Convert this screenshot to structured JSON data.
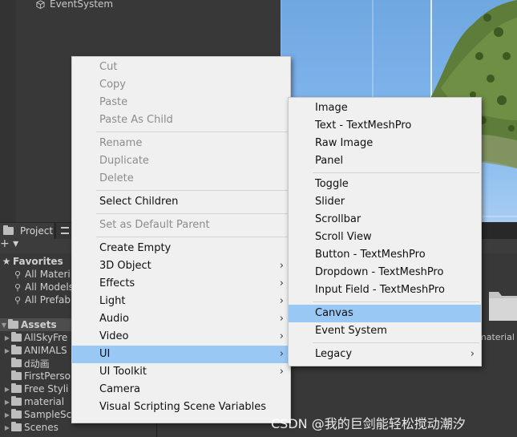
{
  "hierarchy": {
    "items": [
      {
        "label": "EventSystem"
      }
    ]
  },
  "project_panel": {
    "tab_label": "Project",
    "favorites": {
      "label": "Favorites",
      "items": [
        "All Materi",
        "All Models",
        "All Prefab"
      ]
    },
    "assets": {
      "label": "Assets",
      "folders": [
        "AllSkyFre",
        "ANIMALS",
        "d动画",
        "FirstPerso",
        "Free Styli",
        "material",
        "SampleSc",
        "Scenes"
      ]
    },
    "grid_folder_label": "material"
  },
  "context_menu": {
    "items": [
      {
        "label": "Cut",
        "disabled": true
      },
      {
        "label": "Copy",
        "disabled": true
      },
      {
        "label": "Paste",
        "disabled": true
      },
      {
        "label": "Paste As Child",
        "disabled": true
      },
      {
        "label": "Rename",
        "disabled": true
      },
      {
        "label": "Duplicate",
        "disabled": true
      },
      {
        "label": "Delete",
        "disabled": true
      },
      {
        "label": "Select Children",
        "disabled": false
      },
      {
        "label": "Set as Default Parent",
        "disabled": true
      },
      {
        "label": "Create Empty",
        "disabled": false
      },
      {
        "label": "3D Object",
        "disabled": false,
        "submenu": true
      },
      {
        "label": "Effects",
        "disabled": false,
        "submenu": true
      },
      {
        "label": "Light",
        "disabled": false,
        "submenu": true
      },
      {
        "label": "Audio",
        "disabled": false,
        "submenu": true
      },
      {
        "label": "Video",
        "disabled": false,
        "submenu": true
      },
      {
        "label": "UI",
        "disabled": false,
        "submenu": true,
        "highlighted": true
      },
      {
        "label": "UI Toolkit",
        "disabled": false,
        "submenu": true
      },
      {
        "label": "Camera",
        "disabled": false
      },
      {
        "label": "Visual Scripting Scene Variables",
        "disabled": false
      }
    ]
  },
  "ui_submenu": {
    "items": [
      {
        "label": "Image"
      },
      {
        "label": "Text - TextMeshPro"
      },
      {
        "label": "Raw Image"
      },
      {
        "label": "Panel"
      },
      {
        "label": "Toggle"
      },
      {
        "label": "Slider"
      },
      {
        "label": "Scrollbar"
      },
      {
        "label": "Scroll View"
      },
      {
        "label": "Button - TextMeshPro"
      },
      {
        "label": "Dropdown - TextMeshPro"
      },
      {
        "label": "Input Field - TextMeshPro"
      },
      {
        "label": "Canvas",
        "highlighted": true
      },
      {
        "label": "Event System"
      },
      {
        "label": "Legacy",
        "submenu": true
      }
    ]
  },
  "glyphs": {
    "submenu_arrow": "›",
    "plus": "+ ▾",
    "collapse": "▼",
    "expand": "▶"
  },
  "colors": {
    "highlight": "#99c8f5",
    "menu_bg": "#f0f0f0",
    "disabled_text": "#8c8c8c",
    "editor_bg": "#383838"
  },
  "watermark": "CSDN @我的巨剑能轻松搅动潮汐"
}
